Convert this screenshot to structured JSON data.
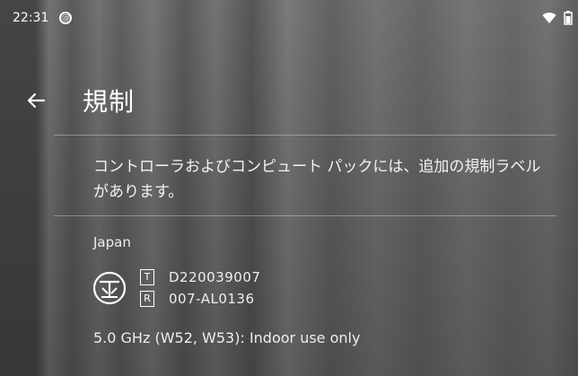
{
  "status_bar": {
    "time": "22:31",
    "notification_icon": "at-circle-icon",
    "wifi_icon": "wifi-icon",
    "battery_icon": "battery-icon"
  },
  "app_bar": {
    "back_icon": "arrow-left-icon",
    "title": "規制"
  },
  "content": {
    "description": "コントローラおよびコンピュート パックには、追加の規制ラベルがあります。",
    "region": "Japan",
    "certifications": [
      {
        "letter": "T",
        "value": "D220039007"
      },
      {
        "letter": "R",
        "value": "007-AL0136"
      }
    ],
    "band_note": "5.0 GHz (W52, W53): Indoor use only"
  }
}
